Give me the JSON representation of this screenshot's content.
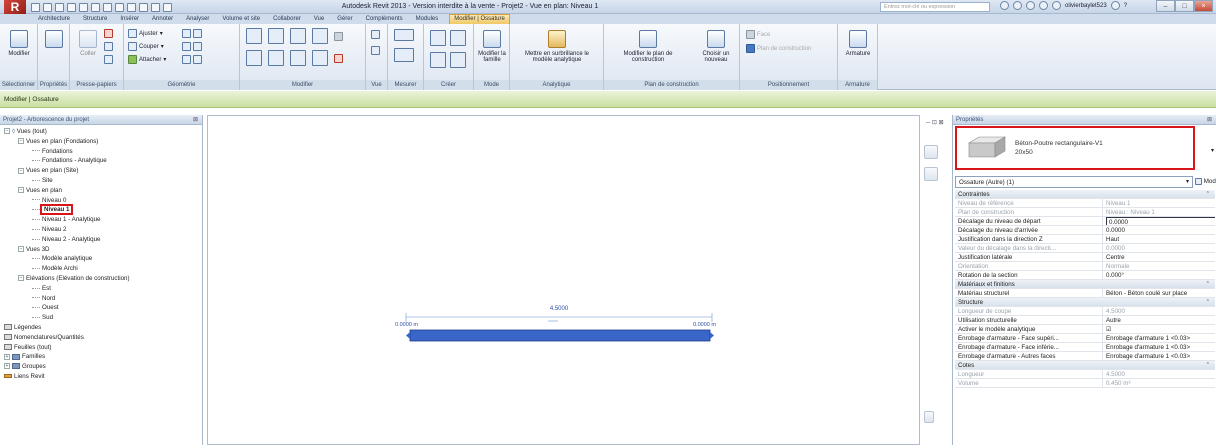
{
  "app": {
    "logo": "R",
    "title": "Autodesk Revit 2013 - Version interdite à la vente -    Projet2 - Vue en plan: Niveau 1",
    "search_placeholder": "Entrez mot-clé ou expression",
    "user": "olivierbaylet523",
    "help": "?"
  },
  "tabs": [
    "Architecture",
    "Structure",
    "Insérer",
    "Annoter",
    "Analyser",
    "Volume et site",
    "Collaborer",
    "Vue",
    "Gérer",
    "Compléments",
    "Modules",
    "Modifier | Ossature"
  ],
  "active_tab": "Modifier | Ossature",
  "ribbon": {
    "select_label": "Modifier",
    "group_labels": [
      "Sélectionner",
      "Propriétés",
      "Presse-papiers",
      "Géométrie",
      "Modifier",
      "Vue",
      "Mesurer",
      "Créer",
      "Mode",
      "Analytique",
      "Plan de construction",
      "Positionnement",
      "Armature"
    ],
    "clip_paste": "Coller",
    "geo_items": [
      "Ajuster",
      "Couper",
      "Attacher"
    ],
    "mode_btn": "Modifier la famille",
    "analytic_btn": "Mettre en surbrillance le modèle analytique",
    "plane_btn_1": "Modifier le plan de construction",
    "plane_btn_2": "Choisir un nouveau",
    "pos_items": [
      "Face",
      "Plan de construction"
    ],
    "armature_btn": "Armature"
  },
  "context_bar": "Modifier | Ossature",
  "browser": {
    "title": "Projet2 - Arborescence du projet",
    "nodes": [
      {
        "label": "Vues (tout)",
        "level": 0,
        "sw": "−",
        "icon": "views"
      },
      {
        "label": "Vues en plan (Fondations)",
        "level": 1,
        "sw": "−"
      },
      {
        "label": "Fondations",
        "level": 2
      },
      {
        "label": "Fondations - Analytique",
        "level": 2
      },
      {
        "label": "Vues en plan (Site)",
        "level": 1,
        "sw": "−"
      },
      {
        "label": "Site",
        "level": 2
      },
      {
        "label": "Vues en plan",
        "level": 1,
        "sw": "−"
      },
      {
        "label": "Niveau 0",
        "level": 2
      },
      {
        "label": "Niveau 1",
        "level": 2,
        "selected": true
      },
      {
        "label": "Niveau 1 - Analytique",
        "level": 2
      },
      {
        "label": "Niveau 2",
        "level": 2
      },
      {
        "label": "Niveau 2 - Analytique",
        "level": 2
      },
      {
        "label": "Vues 3D",
        "level": 1,
        "sw": "−"
      },
      {
        "label": "Modèle analytique",
        "level": 2
      },
      {
        "label": "Modèle Archi",
        "level": 2
      },
      {
        "label": "Elévations (Elévation de construction)",
        "level": 1,
        "sw": "−"
      },
      {
        "label": "Est",
        "level": 2
      },
      {
        "label": "Nord",
        "level": 2
      },
      {
        "label": "Ouest",
        "level": 2
      },
      {
        "label": "Sud",
        "level": 2
      },
      {
        "label": "Légendes",
        "level": 0,
        "icon": "leg"
      },
      {
        "label": "Nomenclatures/Quantités",
        "level": 0,
        "icon": "leg"
      },
      {
        "label": "Feuilles (tout)",
        "level": 0,
        "icon": "leg"
      },
      {
        "label": "Familles",
        "level": 0,
        "sw": "+",
        "icon": "fam"
      },
      {
        "label": "Groupes",
        "level": 0,
        "sw": "+",
        "icon": "fam"
      },
      {
        "label": "Liens Revit",
        "level": 0,
        "icon": "lnk"
      }
    ]
  },
  "canvas": {
    "dim_total": "4.5000",
    "dim_left": "0.0000 m",
    "dim_right": "0.0000 m",
    "beam_color": "#3a66c9"
  },
  "properties": {
    "title": "Propriétés",
    "type_name": "Béton-Poutre rectangulaire-V1",
    "type_size": "20x50",
    "instance_selector": "Ossature (Autre) (1)",
    "edit_type": "Modifier le type",
    "rows": [
      {
        "cat": "Contraintes"
      },
      {
        "name": "Niveau de référence",
        "value": "Niveau 1",
        "ro": true
      },
      {
        "name": "Plan de construction",
        "value": "Niveau : Niveau 1",
        "ro": true
      },
      {
        "name": "Décalage du niveau de départ",
        "value": "0.0000",
        "edit": true
      },
      {
        "name": "Décalage du niveau d'arrivée",
        "value": "0.0000"
      },
      {
        "name": "Justification dans la direction Z",
        "value": "Haut"
      },
      {
        "name": "Valeur du décalage dans la directi...",
        "value": "0.0000",
        "ro": true
      },
      {
        "name": "Justification latérale",
        "value": "Centre"
      },
      {
        "name": "Orientation",
        "value": "Normale",
        "ro": true
      },
      {
        "name": "Rotation de la section",
        "value": "0.000°"
      },
      {
        "cat": "Matériaux et finitions"
      },
      {
        "name": "Matériau structurel",
        "value": "Béton - Béton coulé sur place"
      },
      {
        "cat": "Structure"
      },
      {
        "name": "Longueur de coupe",
        "value": "4.5000",
        "ro": true
      },
      {
        "name": "Utilisation structurelle",
        "value": "Autre"
      },
      {
        "name": "Activer le modèle analytique",
        "value": "☑"
      },
      {
        "name": "Enrobage d'armature - Face supéri...",
        "value": "Enrobage d'armature 1 <0.03>"
      },
      {
        "name": "Enrobage d'armature - Face inférie...",
        "value": "Enrobage d'armature 1 <0.03>"
      },
      {
        "name": "Enrobage d'armature - Autres faces",
        "value": "Enrobage d'armature 1 <0.03>"
      },
      {
        "cat": "Cotes"
      },
      {
        "name": "Longueur",
        "value": "4.5000",
        "ro": true
      },
      {
        "name": "Volume",
        "value": "0.450 m³",
        "ro": true
      }
    ]
  }
}
